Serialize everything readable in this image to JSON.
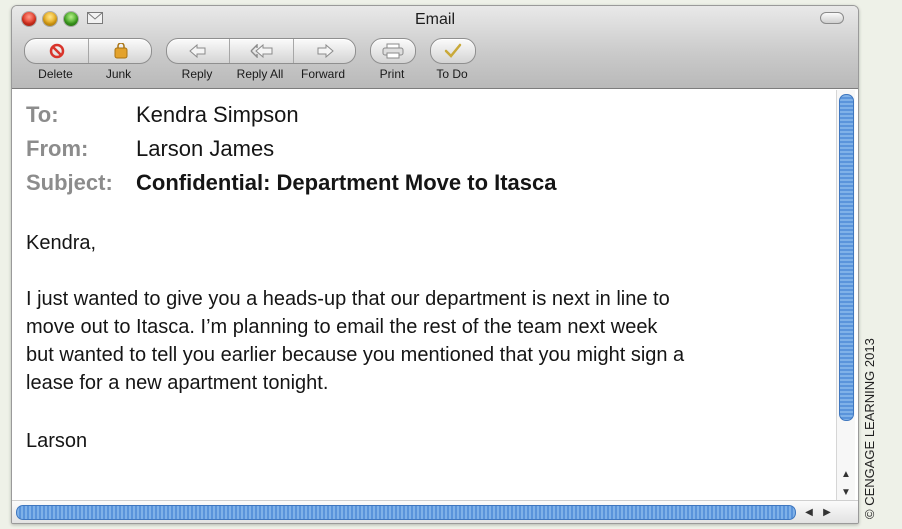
{
  "window": {
    "title": "Email"
  },
  "toolbar": {
    "delete": "Delete",
    "junk": "Junk",
    "reply": "Reply",
    "reply_all": "Reply All",
    "forward": "Forward",
    "print": "Print",
    "todo": "To Do"
  },
  "headers": {
    "to_label": "To:",
    "to_value": "Kendra Simpson",
    "from_label": "From:",
    "from_value": "Larson James",
    "subject_label": "Subject:",
    "subject_value": "Confidential: Department Move to Itasca"
  },
  "message": {
    "greeting": "Kendra,",
    "line1": "I just wanted to give you a heads-up that our department is next in line to",
    "line2": "move out to Itasca. I’m planning to email the rest of the team next week",
    "line3": "but wanted to tell you earlier because you mentioned that you might sign a",
    "line4": "lease for a new apartment tonight.",
    "signature": "Larson"
  },
  "copyright": "© CENGAGE LEARNING 2013",
  "colors": {
    "delete_icon": "#d9342b",
    "junk_icon": "#e3a22c",
    "todo_icon": "#c9a93a",
    "scroll_thumb": "#5a94db"
  }
}
